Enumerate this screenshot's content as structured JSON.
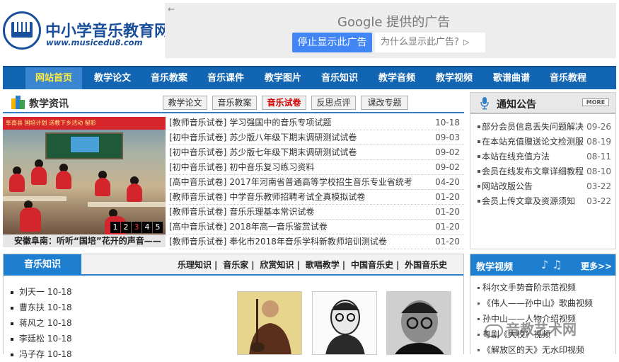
{
  "header": {
    "site_name": "中小学音乐教育网",
    "site_url": "www.musicedu8.com",
    "logo_arc_text": "music education"
  },
  "ad": {
    "back_icon": "back-arrow-icon",
    "title": "Google 提供的广告",
    "stop_button": "停止显示此广告",
    "why_button": "为什么显示此广告?",
    "why_icon": "play-triangle-icon"
  },
  "nav": {
    "items": [
      "网站首页",
      "教学论文",
      "音乐教案",
      "音乐课件",
      "教学图片",
      "音乐知识",
      "教学音频",
      "教学视频",
      "歌谱曲谱",
      "音乐教程"
    ],
    "active_index": 0
  },
  "news": {
    "title": "教学资讯",
    "tabs": [
      "教学论文",
      "音乐教案",
      "音乐试卷",
      "反思点评",
      "课改专题"
    ],
    "active_tab": 2,
    "photo_caption": "安徽阜南：听听“国培”花开的声音——",
    "photo_banner": "阜南县  国培计划  送教下乡活动  留影",
    "photo_pager": [
      "1",
      "2",
      "3",
      "4",
      "5"
    ],
    "photo_pager_active": 2,
    "items": [
      {
        "cat": "[教师音乐试卷]",
        "title": "学习强国中的音乐专项试题",
        "date": "10-18"
      },
      {
        "cat": "[初中音乐试卷]",
        "title": "苏少版八年级下期末调研测试试卷",
        "date": "09-03"
      },
      {
        "cat": "[初中音乐试卷]",
        "title": "苏少版七年级下期末调研测试试卷",
        "date": "09-02"
      },
      {
        "cat": "[初中音乐试卷]",
        "title": "初中音乐复习练习资料",
        "date": "09-02"
      },
      {
        "cat": "[高中音乐试卷]",
        "title": "2017年河南省普通高等学校招生音乐专业省统考",
        "date": "04-20"
      },
      {
        "cat": "[教师音乐试卷]",
        "title": "中学音乐教师招聘考试全真模拟试卷",
        "date": "01-20"
      },
      {
        "cat": "[教师音乐试卷]",
        "title": "音乐乐理基本常识试卷",
        "date": "01-20"
      },
      {
        "cat": "[高中音乐试卷]",
        "title": "2018年高一音乐鉴赏试卷",
        "date": "01-20"
      },
      {
        "cat": "[教师音乐试卷]",
        "title": "奉化市2018年音乐学科新教师培训测试卷",
        "date": "01-20"
      }
    ]
  },
  "notice": {
    "title": "通知公告",
    "more_label": "MORE",
    "items": [
      {
        "title": "部分会员信息丢失问题解决",
        "date": "09-26"
      },
      {
        "title": "在本站充值赠送论文检测服",
        "date": "08-19"
      },
      {
        "title": "本站在线充值方法",
        "date": "08-11"
      },
      {
        "title": "会员在线发布文章详细教程",
        "date": "08-10"
      },
      {
        "title": "网站改版公告",
        "date": "03-22"
      },
      {
        "title": "会员上传文章及资源须知",
        "date": "03-22"
      }
    ]
  },
  "music_knowledge": {
    "title": "音乐知识",
    "links": [
      "乐理知识",
      "音乐家",
      "欣赏知识",
      "歌唱教学",
      "中国音乐史",
      "外国音乐史"
    ],
    "items": [
      "刘天一  10-18",
      "曹东扶  10-18",
      "蒋风之  10-18",
      "李廷松  10-18",
      "冯子存  10-18"
    ]
  },
  "video": {
    "title": "教学视频",
    "more_label": "更多>>",
    "items": [
      "科尔文手势音阶示范视频",
      "《伟人——孙中山》歌曲视频",
      "孙中山——人物介绍视频",
      "粤剧《大校》视频",
      "《解放区的天》无水印视频"
    ]
  },
  "watermark": {
    "text": "音教艺术网"
  },
  "colors": {
    "nav_bg": "#1265b3",
    "accent_blue": "#1e7fd0",
    "active_tab_text": "#d40000",
    "ad_button": "#4285f4"
  }
}
